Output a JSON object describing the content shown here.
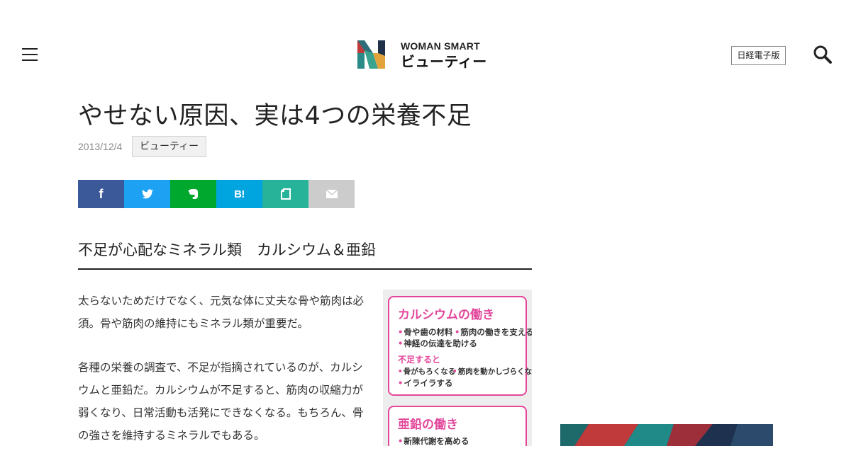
{
  "header": {
    "logo_en": "WOMAN SMART",
    "logo_ja": "ビューティー",
    "edition_label": "日経電子版"
  },
  "article": {
    "title": "やせない原因、実は4つの栄養不足",
    "date": "2013/12/4",
    "category": "ビューティー",
    "share": [
      "facebook",
      "twitter",
      "evernote",
      "hatena-bookmark",
      "pocket",
      "mail"
    ],
    "section_heading": "不足が心配なミネラル類　カルシウム＆亜鉛",
    "paragraphs": [
      "太らないためだけでなく、元気な体に丈夫な骨や筋肉は必須。骨や筋肉の維持にもミネラル類が重要だ。",
      "各種の栄養の調査で、不足が指摘されているのが、カルシウムと亜鉛だ。カルシウムが不足すると、筋肉の収縮力が弱くなり、日常活動も活発にできなくなる。もちろん、骨の強さを維持するミネラルでもある。"
    ]
  },
  "figure": {
    "calcium_title": "カルシウムの働き",
    "calcium_benefit_1": "骨や歯の材料",
    "calcium_benefit_2": "筋肉の働きを支える",
    "calcium_benefit_3": "神経の伝達を助ける",
    "calcium_deficit_heading": "不足すると",
    "calcium_deficit_1": "骨がもろくなる",
    "calcium_deficit_2": "筋肉を動かしづらくなる",
    "calcium_deficit_3": "イライラする",
    "zinc_title": "亜鉛の働き",
    "zinc_benefit_1": "新陳代謝を高める"
  },
  "colors": {
    "facebook": "#3b5998",
    "twitter": "#1da1f2",
    "evernote": "#00a82d",
    "hatena": "#00a4de",
    "pocket": "#26b39a",
    "mail": "#cccccc",
    "figure_accent": "#e3479b"
  }
}
